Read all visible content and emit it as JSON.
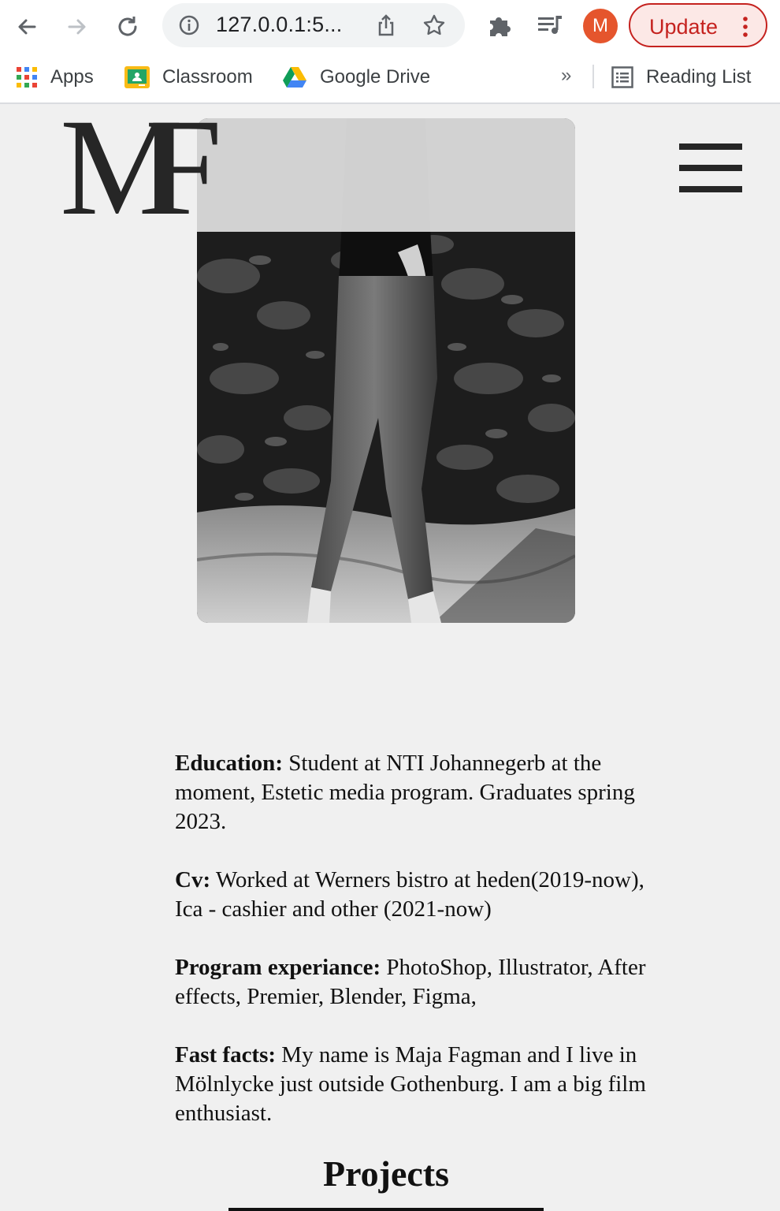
{
  "browser": {
    "url": "127.0.0.1:5...",
    "avatar_letter": "M",
    "update_label": "Update",
    "update_color": "#c5221f",
    "avatar_color": "#e5552d",
    "bookmarks": [
      {
        "label": "Apps",
        "icon": "apps-grid-icon"
      },
      {
        "label": "Classroom",
        "icon": "classroom-icon"
      },
      {
        "label": "Google Drive",
        "icon": "google-drive-icon"
      }
    ],
    "overflow_label": "»",
    "reading_list_label": "Reading List"
  },
  "site": {
    "logo_m": "M",
    "logo_f": "F",
    "about": [
      {
        "heading": "Education:",
        "text": " Student at NTI Johannegerb at the moment, Estetic media program. Graduates spring 2023."
      },
      {
        "heading": "Cv:",
        "text": " Worked at Werners bistro at heden(2019-now), Ica - cashier and other (2021-now)"
      },
      {
        "heading": "Program experiance:",
        "text": " PhotoShop, Illustrator, After effects, Premier, Blender, Figma,"
      },
      {
        "heading": "Fast facts:",
        "text": " My name is Maja Fagman and I live in Mölnlycke just outside Gothenburg. I am a big film enthusiast."
      }
    ],
    "projects_title": "Projects"
  }
}
